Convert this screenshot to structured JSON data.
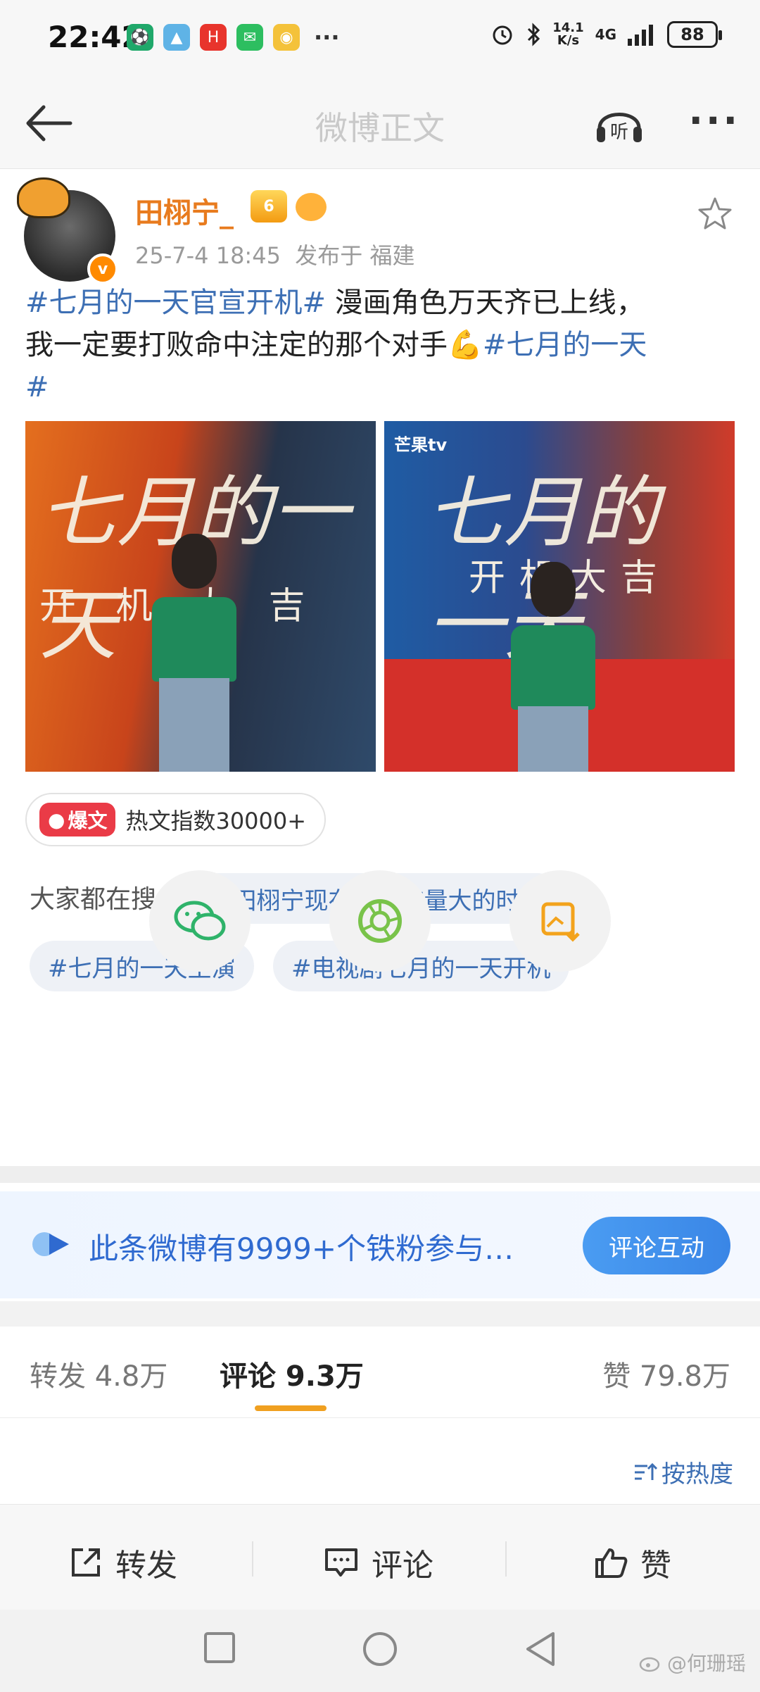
{
  "status_bar": {
    "time": "22:42",
    "net_speed_value": "14.1",
    "net_speed_unit": "K/s",
    "network": "4G",
    "battery": "88"
  },
  "nav": {
    "title": "微博正文",
    "listen_label": "听"
  },
  "post": {
    "username": "田栩宁_",
    "badge_level": "6",
    "timestamp": "25-7-4 18:45",
    "location": "发布于 福建",
    "verified_mark": "v",
    "content": {
      "tag1": "#七月的一天官宣开机#",
      "text1": " 漫画角色万天齐已上线，",
      "text2": "我一定要打败命中注定的那个对手💪",
      "tag2": "#七月的一天",
      "tag3": "#"
    },
    "images": [
      {
        "title": "七月的一天",
        "subtitle": "开 机 大 吉",
        "logo": ""
      },
      {
        "title": "七月的一天",
        "subtitle": "开机大吉",
        "logo": "芒果tv"
      }
    ],
    "hot": {
      "badge": "爆文",
      "text": "热文指数30000+"
    },
    "searching": {
      "label": "大家都在搜",
      "chips": [
        "#田栩宁现在正是流量大的时候",
        "#七月的一天主演",
        "#电视剧七月的一天开机"
      ]
    }
  },
  "share": {
    "wechat_icon": "wechat-icon",
    "moments_icon": "moments-icon",
    "save_image_icon": "save-image-icon"
  },
  "fan_banner": {
    "text": "此条微博有9999+个铁粉参与…",
    "button": "评论互动"
  },
  "tabs": {
    "repost": "转发 4.8万",
    "comment": "评论 9.3万",
    "like": "赞 79.8万"
  },
  "sort": {
    "label": "按热度"
  },
  "actions": {
    "repost": "转发",
    "comment": "评论",
    "like": "赞"
  },
  "watermark": "@何珊瑶",
  "colors": {
    "link": "#3d6fb4",
    "username": "#e87b1e",
    "accent": "#f0a020",
    "button_blue": "#3a86e6"
  }
}
